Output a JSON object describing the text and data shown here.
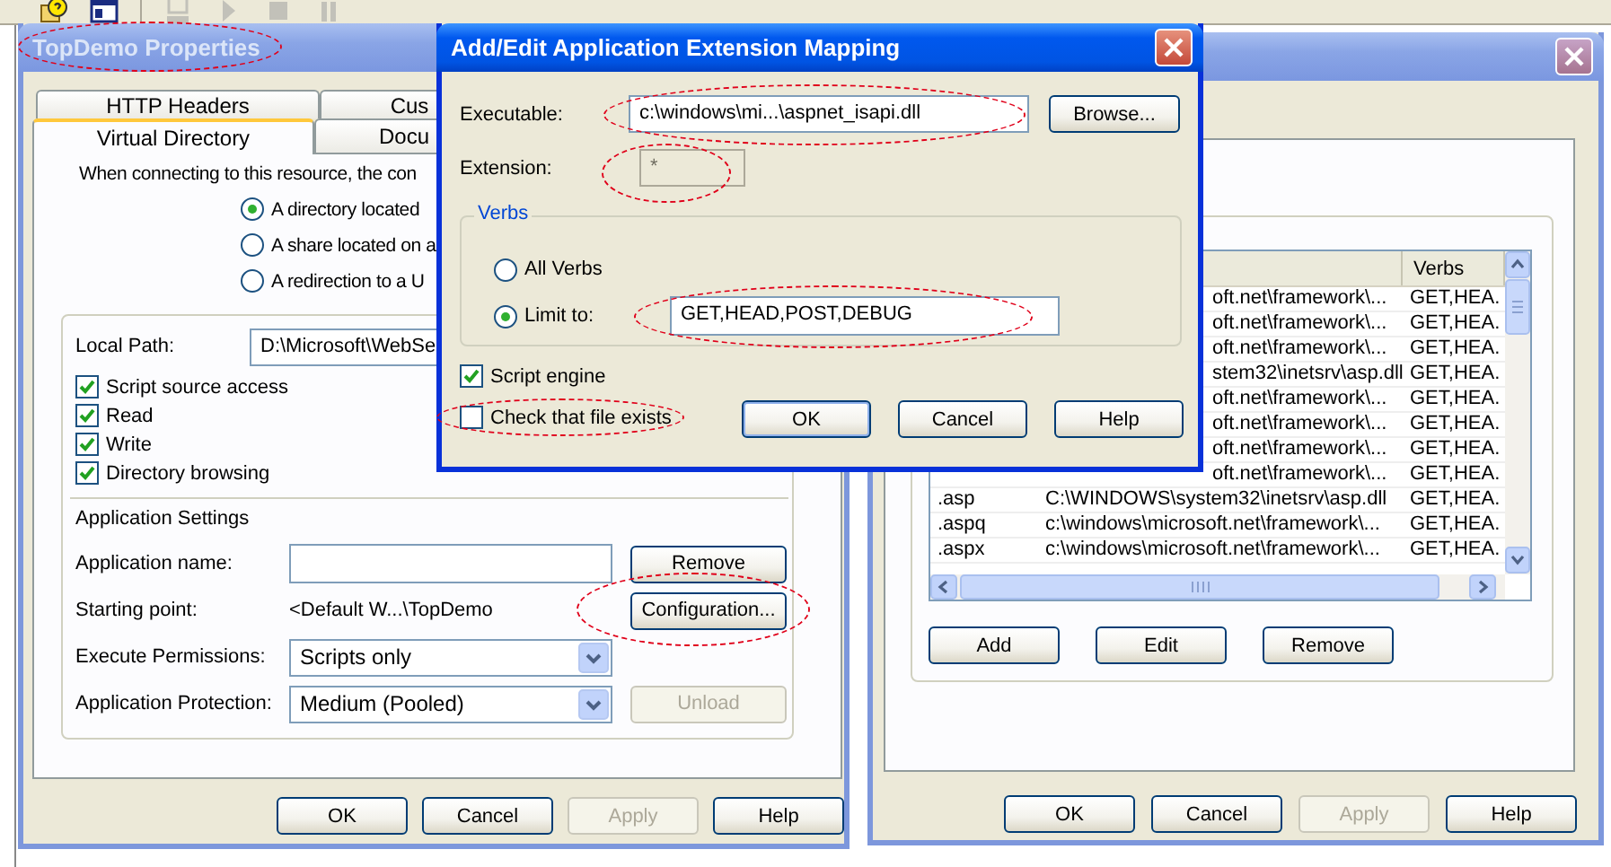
{
  "toolbar": [
    {
      "kind": "help",
      "disabled": false
    },
    {
      "kind": "console",
      "disabled": false
    },
    {
      "kind": "computer",
      "disabled": true
    },
    {
      "kind": "play",
      "disabled": true
    },
    {
      "kind": "stop",
      "disabled": true
    },
    {
      "kind": "pause",
      "disabled": true
    }
  ],
  "properties_window": {
    "title": "TopDemo Properties",
    "title_highlighted": true,
    "tab_rows": [
      [
        {
          "label": "HTTP Headers",
          "selected": false
        },
        {
          "label": "Cus",
          "selected": false
        }
      ],
      [
        {
          "label": "Virtual Directory",
          "selected": true
        },
        {
          "label": "Docu",
          "selected": false
        }
      ]
    ],
    "intro": "When connecting to this resource, the con",
    "source_options": [
      {
        "label": "A directory located",
        "selected": true
      },
      {
        "label": "A share located on a",
        "selected": false
      },
      {
        "label": "A redirection to a U",
        "selected": false
      }
    ],
    "local_path": {
      "label": "Local Path:",
      "value": "D:\\Microsoft\\WebSe"
    },
    "permissions": [
      {
        "label": "Script source access",
        "checked": true
      },
      {
        "label": "Read",
        "checked": true
      },
      {
        "label": "Write",
        "checked": true
      },
      {
        "label": "Directory browsing",
        "checked": true
      }
    ],
    "app_settings_heading": "Application Settings",
    "app_settings": [
      {
        "kind": "field",
        "label": "Application name:",
        "button": {
          "label": "Remove",
          "disabled": false,
          "highlighted": false
        }
      },
      {
        "kind": "text",
        "label": "Starting point:",
        "value": "<Default W...\\TopDemo",
        "button": {
          "label": "Configuration...",
          "disabled": false,
          "highlighted": true
        }
      },
      {
        "kind": "select",
        "label": "Execute Permissions:",
        "value": "Scripts only"
      },
      {
        "kind": "select",
        "label": "Application Protection:",
        "value": "Medium (Pooled)",
        "button": {
          "label": "Unload",
          "disabled": true,
          "highlighted": false
        }
      }
    ],
    "buttons": [
      {
        "label": "OK",
        "disabled": false
      },
      {
        "label": "Cancel",
        "disabled": false
      },
      {
        "label": "Apply",
        "disabled": true
      },
      {
        "label": "Help",
        "disabled": false
      }
    ]
  },
  "configuration_window": {
    "columns": [
      "Verbs"
    ],
    "rows": [
      {
        "path": "oft.net\\framework\\...",
        "verbs": "GET,HEA."
      },
      {
        "path": "oft.net\\framework\\...",
        "verbs": "GET,HEA."
      },
      {
        "path": "oft.net\\framework\\...",
        "verbs": "GET,HEA."
      },
      {
        "path": "stem32\\inetsrv\\asp.dll",
        "verbs": "GET,HEA."
      },
      {
        "path": "oft.net\\framework\\...",
        "verbs": "GET,HEA."
      },
      {
        "path": "oft.net\\framework\\...",
        "verbs": "GET,HEA."
      },
      {
        "path": "oft.net\\framework\\...",
        "verbs": "GET,HEA."
      },
      {
        "path": "oft.net\\framework\\...",
        "verbs": "GET,HEA."
      },
      {
        "extension": ".asp",
        "path": "C:\\WINDOWS\\system32\\inetsrv\\asp.dll",
        "verbs": "GET,HEA."
      },
      {
        "extension": ".aspq",
        "path": "c:\\windows\\microsoft.net\\framework\\...",
        "verbs": "GET,HEA."
      },
      {
        "extension": ".aspx",
        "path": "c:\\windows\\microsoft.net\\framework\\...",
        "verbs": "GET,HEA."
      }
    ],
    "list_buttons": [
      "Add",
      "Edit",
      "Remove"
    ],
    "buttons": [
      {
        "label": "OK",
        "disabled": false
      },
      {
        "label": "Cancel",
        "disabled": false
      },
      {
        "label": "Apply",
        "disabled": true
      },
      {
        "label": "Help",
        "disabled": false
      }
    ]
  },
  "mapping_dialog": {
    "title": "Add/Edit Application Extension Mapping",
    "executable": {
      "label": "Executable:",
      "value": "c:\\windows\\mi...\\aspnet_isapi.dll",
      "highlighted": true
    },
    "browse_button": "Browse...",
    "extension": {
      "label": "Extension:",
      "value": "*",
      "disabled": true,
      "highlighted": true
    },
    "verbs": {
      "legend": "Verbs",
      "options": [
        {
          "label": "All Verbs",
          "selected": false
        },
        {
          "label": "Limit to:",
          "selected": true,
          "value": "GET,HEAD,POST,DEBUG",
          "highlighted": true
        }
      ]
    },
    "checks": [
      {
        "label": "Script engine",
        "checked": true,
        "highlighted": false
      },
      {
        "label": "Check that file exists",
        "checked": false,
        "highlighted": true
      }
    ],
    "buttons": [
      {
        "label": "OK",
        "default": true
      },
      {
        "label": "Cancel",
        "default": false
      },
      {
        "label": "Help",
        "default": false
      }
    ]
  }
}
